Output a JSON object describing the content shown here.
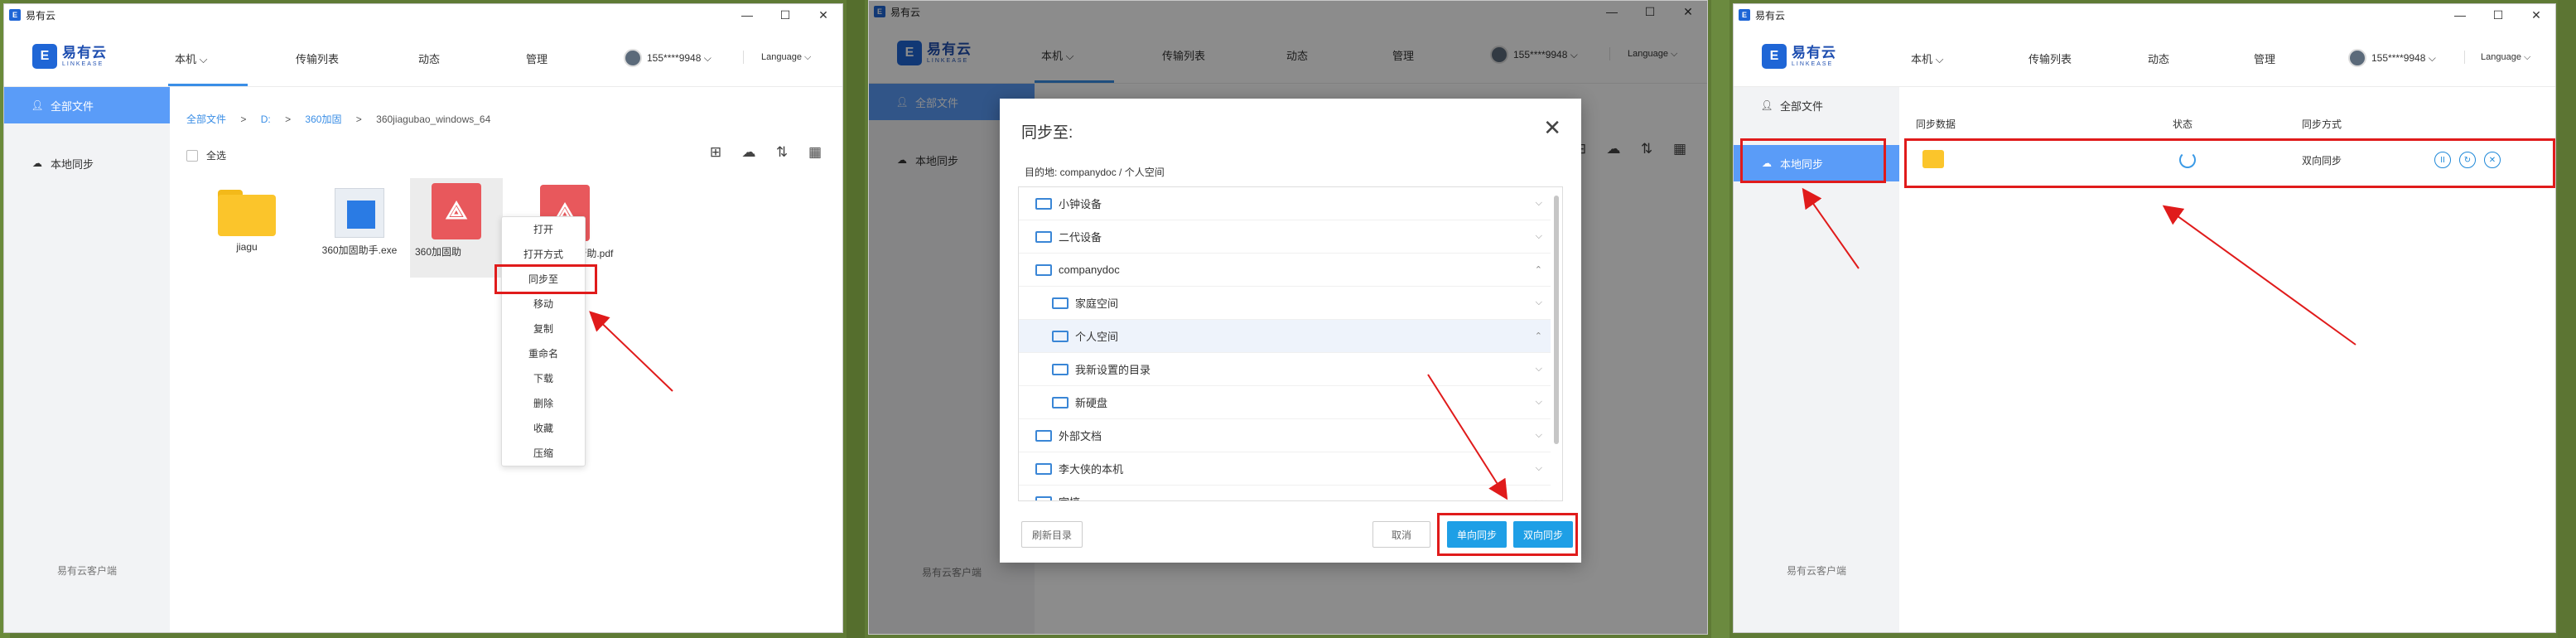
{
  "app": {
    "title": "易有云",
    "brand_name": "易有云",
    "brand_sub": "LINKEASE",
    "nav": [
      "本机",
      "传输列表",
      "动态",
      "管理"
    ],
    "user": "155****9948",
    "language": "Language",
    "sidebar": [
      "全部文件",
      "本地同步"
    ],
    "footer": "易有云客户端",
    "colors": {
      "accent": "#3a8ee6",
      "sidebar_active": "#5a9cf8",
      "highlight": "#e01b1b"
    }
  },
  "panel1": {
    "breadcrumb": [
      "全部文件",
      "D:",
      "360加固",
      "360jiagubao_windows_64"
    ],
    "select_all": "全选",
    "toolbar_icons": [
      "new-folder-icon",
      "upload-icon",
      "sort-icon",
      "grid-view-icon"
    ],
    "files": [
      {
        "name": "jiagu",
        "kind": "folder"
      },
      {
        "name": "360加固助手.exe",
        "kind": "exe"
      },
      {
        "name": "360加固助",
        "kind": "pdf"
      },
      {
        "name": "SDK加固使用帮助.pdf",
        "kind": "pdf"
      }
    ],
    "context_menu": [
      "打开",
      "打开方式",
      "同步至",
      "移动",
      "复制",
      "重命名",
      "下载",
      "删除",
      "收藏",
      "压缩"
    ]
  },
  "panel2": {
    "dialog_title": "同步至:",
    "target_path": "目的地: companydoc / 个人空间",
    "tree": [
      "小钟设备",
      "二代设备",
      "companydoc",
      "家庭空间",
      "个人空间",
      "我新设置的目录",
      "新硬盘",
      "外部文档",
      "李大侠的本机",
      "家搞"
    ],
    "buttons": {
      "refresh": "刷新目录",
      "cancel": "取消",
      "one_way": "单向同步",
      "two_way": "双向同步"
    }
  },
  "panel3": {
    "columns": [
      "同步数据",
      "状态",
      "同步方式"
    ],
    "row": {
      "mode": "双向同步"
    }
  }
}
